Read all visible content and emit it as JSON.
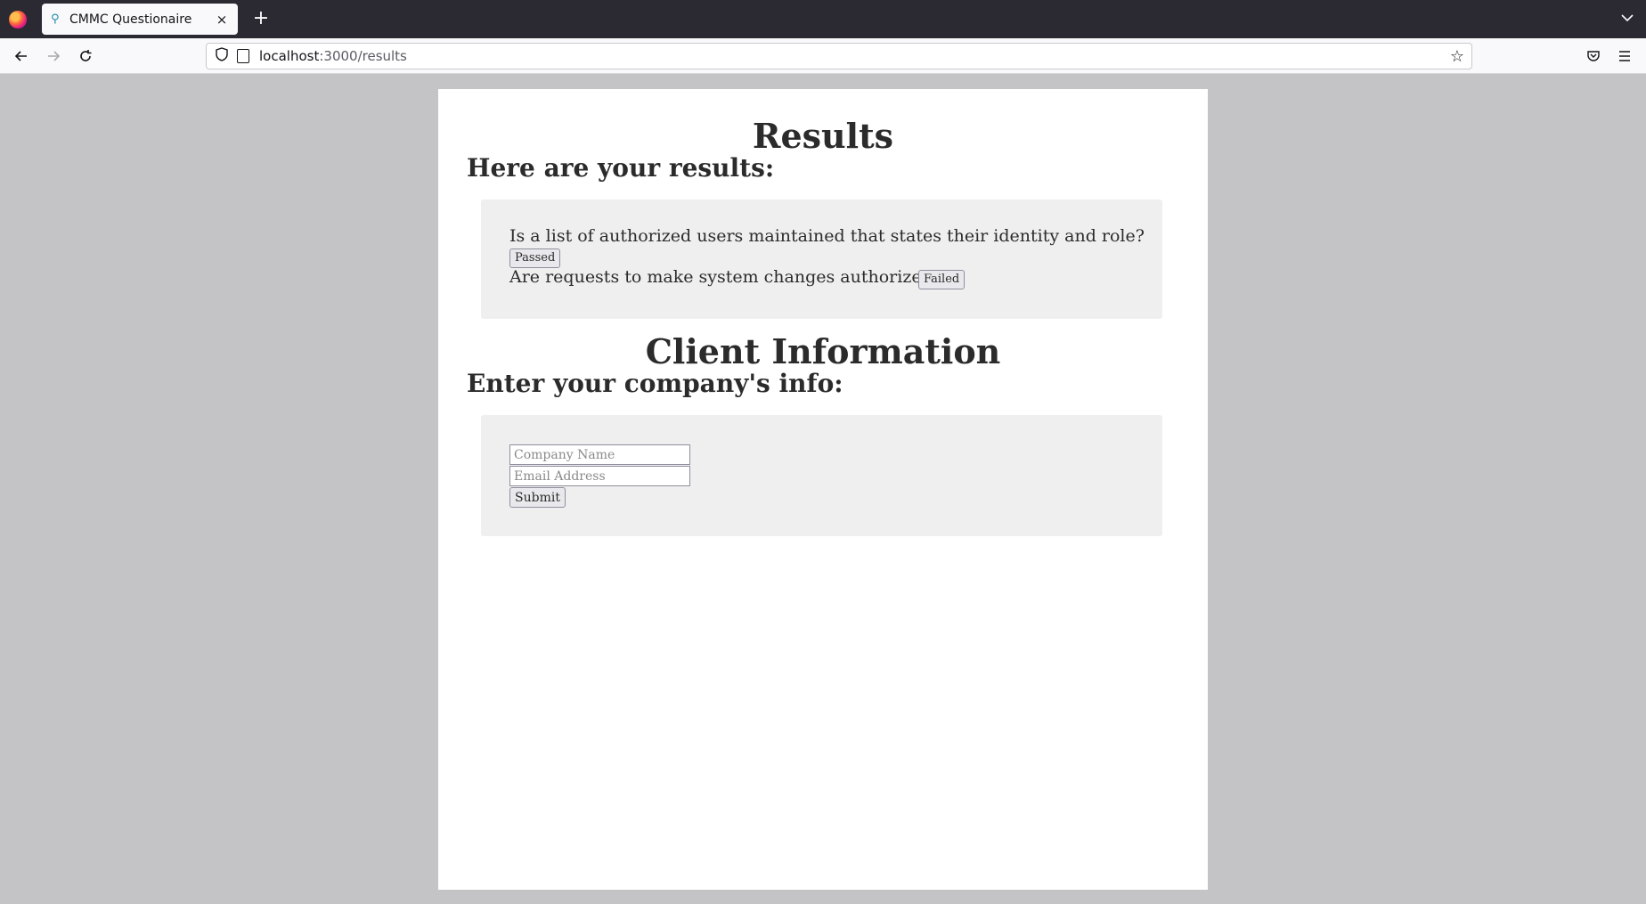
{
  "browser": {
    "tab_title": "CMMC Questionaire",
    "tab_close": "×",
    "new_tab": "+",
    "url_host": "localhost",
    "url_path": ":3000/results"
  },
  "results": {
    "title": "Results",
    "subtitle": "Here are your results:",
    "items": [
      {
        "question": "Is a list of authorized users maintained that states their identity and role?",
        "status": "Passed"
      },
      {
        "question": "Are requests to make system changes authorized?",
        "status": "Failed"
      }
    ]
  },
  "client": {
    "title": "Client Information",
    "subtitle": "Enter your company's info:",
    "company_placeholder": "Company Name",
    "email_placeholder": "Email Address",
    "submit_label": "Submit"
  }
}
